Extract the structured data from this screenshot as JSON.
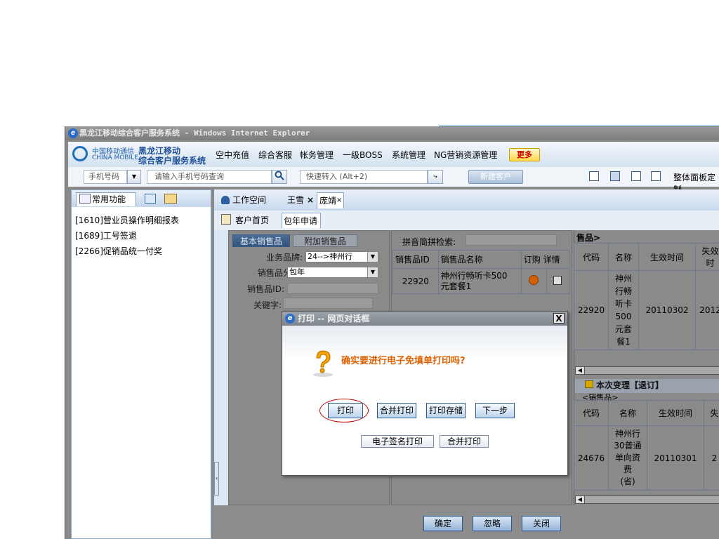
{
  "window": {
    "title": "黑龙江移动综合客户服务系统 - Windows Internet Explorer"
  },
  "logo": {
    "cn": "中国移动通信",
    "en": "CHINA MOBILE",
    "sys_line1": "黑龙江移动",
    "sys_line2": "综合客户服务系统"
  },
  "menu": [
    "空中充值",
    "综合客服",
    "帐务管理",
    "一级BOSS",
    "系统管理",
    "NG营销资源管理"
  ],
  "more_label": "更多",
  "search": {
    "type_label": "手机号码",
    "placeholder": "请输入手机号码查询",
    "quick_placeholder": "快速转入 (Alt+2)",
    "new_customer": "新建客户",
    "panel_settings": "整体面板定制"
  },
  "left_panel": {
    "tab_label": "常用功能",
    "items": [
      "[1610]营业员操作明细报表",
      "[1689]工号签退",
      "[2266]促销品统一付奖"
    ]
  },
  "top_tabs": {
    "workspace": "工作空间",
    "tab1": "王雪",
    "tab1_close": "×",
    "tab2": "庞靖",
    "tab2_close": "×"
  },
  "sub_tabs": {
    "home": "客户首页",
    "package": "包年申请",
    "close": "×"
  },
  "form": {
    "tab_basic": "基本销售品",
    "tab_extra": "附加销售品",
    "brand_label": "业务品牌:",
    "brand_value": "24-->神州行",
    "category_label": "销售品分类:",
    "category_value": "包年",
    "id_label": "销售品ID:",
    "keyword_label": "关键字:"
  },
  "pinyin": {
    "label": "拼音简拼检索:"
  },
  "product_table": {
    "headers": [
      "销售品ID",
      "销售品名称",
      "订购",
      "详情"
    ],
    "rows": [
      {
        "id": "22920",
        "name_line1": "神州行畅听卡500",
        "name_line2": "元套餐1"
      }
    ]
  },
  "right_table1": {
    "title": "售品>",
    "headers": [
      "代码",
      "名称",
      "生效时间",
      "失效时"
    ],
    "row": {
      "code": "22920",
      "name": [
        "神州",
        "行畅",
        "听卡",
        "500",
        "元套",
        "餐1"
      ],
      "start": "20110302",
      "end": "2012"
    }
  },
  "right_table2": {
    "section": "本次变理【退订】",
    "subtitle": "<销售品>",
    "headers": [
      "代码",
      "名称",
      "生效时间",
      "失"
    ],
    "row": {
      "code": "24676",
      "name": [
        "神州行",
        "30普通",
        "单向资",
        "费",
        "(省)"
      ],
      "start": "20110301",
      "end": "2"
    }
  },
  "dialog": {
    "title": "打印 -- 网页对话框",
    "close": "X",
    "message": "确实要进行电子免填单打印吗?",
    "buttons": [
      "打印",
      "合并打印",
      "打印存储",
      "下一步"
    ],
    "buttons2": [
      "电子签名打印",
      "合并打印"
    ]
  },
  "bottom_buttons": [
    "确定",
    "忽略",
    "关闭"
  ],
  "colors": {
    "title_gray": "#8a8a8a",
    "accent_blue": "#1f4f97",
    "warn_orange": "#e06000",
    "highlight_red": "#c00000"
  }
}
